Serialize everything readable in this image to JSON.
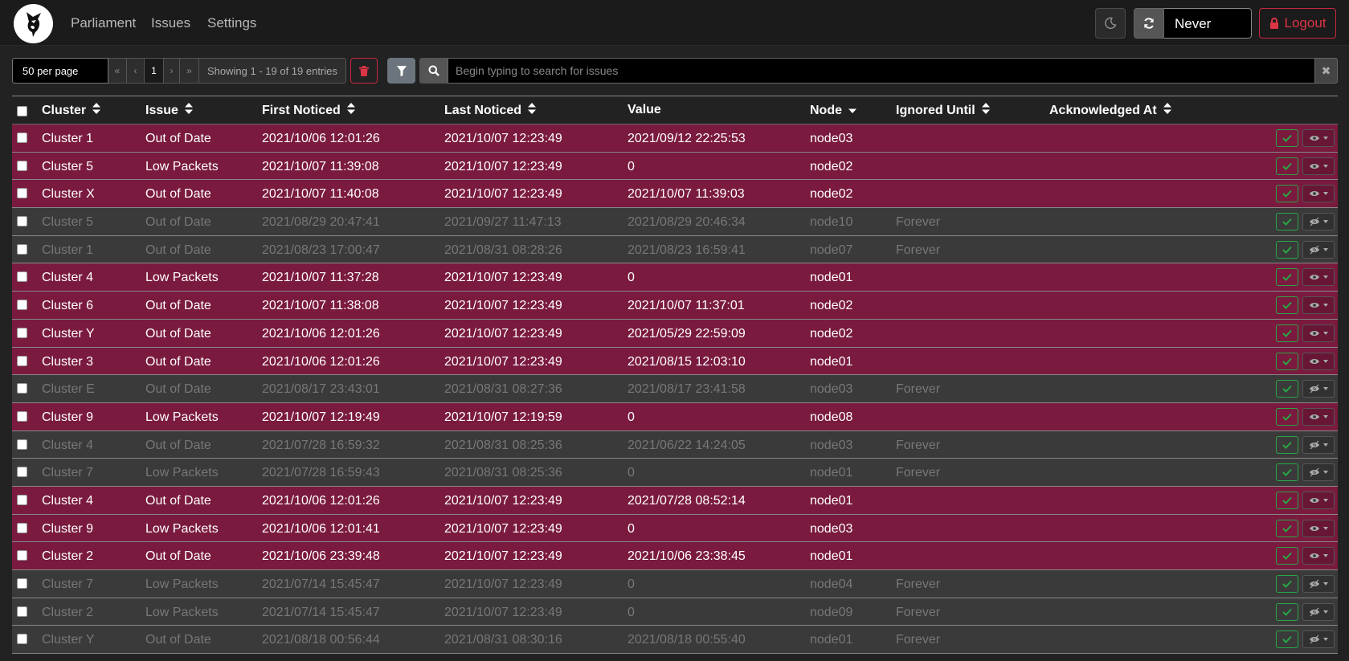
{
  "nav": {
    "links": [
      "Parliament",
      "Issues",
      "Settings"
    ],
    "refresh_value": "Never",
    "logout_label": "Logout"
  },
  "toolbar": {
    "per_page": "50 per page",
    "first": "«",
    "prev": "‹",
    "page": "1",
    "next": "›",
    "last": "»",
    "showing": "Showing 1 - 19 of 19 entries",
    "search_placeholder": "Begin typing to search for issues",
    "clear": "✖"
  },
  "columns": [
    "Cluster",
    "Issue",
    "First Noticed",
    "Last Noticed",
    "Value",
    "Node",
    "Ignored Until",
    "Acknowledged At"
  ],
  "colors": {
    "active_row": "#7a1a3f",
    "ignored_row": "#3a3a3a",
    "danger": "#dc3545",
    "success": "#28a745"
  },
  "rows": [
    {
      "cluster": "Cluster 1",
      "issue": "Out of Date",
      "first": "2021/10/06 12:01:26",
      "last": "2021/10/07 12:23:49",
      "value": "2021/09/12 22:25:53",
      "node": "node03",
      "ignored": "",
      "ack": "",
      "state": "active"
    },
    {
      "cluster": "Cluster 5",
      "issue": "Low Packets",
      "first": "2021/10/07 11:39:08",
      "last": "2021/10/07 12:23:49",
      "value": "0",
      "node": "node02",
      "ignored": "",
      "ack": "",
      "state": "active"
    },
    {
      "cluster": "Cluster X",
      "issue": "Out of Date",
      "first": "2021/10/07 11:40:08",
      "last": "2021/10/07 12:23:49",
      "value": "2021/10/07 11:39:03",
      "node": "node02",
      "ignored": "",
      "ack": "",
      "state": "active"
    },
    {
      "cluster": "Cluster 5",
      "issue": "Out of Date",
      "first": "2021/08/29 20:47:41",
      "last": "2021/09/27 11:47:13",
      "value": "2021/08/29 20:46:34",
      "node": "node10",
      "ignored": "Forever",
      "ack": "",
      "state": "ignored"
    },
    {
      "cluster": "Cluster 1",
      "issue": "Out of Date",
      "first": "2021/08/23 17:00:47",
      "last": "2021/08/31 08:28:26",
      "value": "2021/08/23 16:59:41",
      "node": "node07",
      "ignored": "Forever",
      "ack": "",
      "state": "ignored"
    },
    {
      "cluster": "Cluster 4",
      "issue": "Low Packets",
      "first": "2021/10/07 11:37:28",
      "last": "2021/10/07 12:23:49",
      "value": "0",
      "node": "node01",
      "ignored": "",
      "ack": "",
      "state": "active"
    },
    {
      "cluster": "Cluster 6",
      "issue": "Out of Date",
      "first": "2021/10/07 11:38:08",
      "last": "2021/10/07 12:23:49",
      "value": "2021/10/07 11:37:01",
      "node": "node02",
      "ignored": "",
      "ack": "",
      "state": "active"
    },
    {
      "cluster": "Cluster Y",
      "issue": "Out of Date",
      "first": "2021/10/06 12:01:26",
      "last": "2021/10/07 12:23:49",
      "value": "2021/05/29 22:59:09",
      "node": "node02",
      "ignored": "",
      "ack": "",
      "state": "active"
    },
    {
      "cluster": "Cluster 3",
      "issue": "Out of Date",
      "first": "2021/10/06 12:01:26",
      "last": "2021/10/07 12:23:49",
      "value": "2021/08/15 12:03:10",
      "node": "node01",
      "ignored": "",
      "ack": "",
      "state": "active"
    },
    {
      "cluster": "Cluster E",
      "issue": "Out of Date",
      "first": "2021/08/17 23:43:01",
      "last": "2021/08/31 08:27:36",
      "value": "2021/08/17 23:41:58",
      "node": "node03",
      "ignored": "Forever",
      "ack": "",
      "state": "ignored"
    },
    {
      "cluster": "Cluster 9",
      "issue": "Low Packets",
      "first": "2021/10/07 12:19:49",
      "last": "2021/10/07 12:19:59",
      "value": "0",
      "node": "node08",
      "ignored": "",
      "ack": "",
      "state": "active"
    },
    {
      "cluster": "Cluster 4",
      "issue": "Out of Date",
      "first": "2021/07/28 16:59:32",
      "last": "2021/08/31 08:25:36",
      "value": "2021/06/22 14:24:05",
      "node": "node03",
      "ignored": "Forever",
      "ack": "",
      "state": "ignored"
    },
    {
      "cluster": "Cluster 7",
      "issue": "Low Packets",
      "first": "2021/07/28 16:59:43",
      "last": "2021/08/31 08:25:36",
      "value": "0",
      "node": "node01",
      "ignored": "Forever",
      "ack": "",
      "state": "ignored"
    },
    {
      "cluster": "Cluster 4",
      "issue": "Out of Date",
      "first": "2021/10/06 12:01:26",
      "last": "2021/10/07 12:23:49",
      "value": "2021/07/28 08:52:14",
      "node": "node01",
      "ignored": "",
      "ack": "",
      "state": "active"
    },
    {
      "cluster": "Cluster 9",
      "issue": "Low Packets",
      "first": "2021/10/06 12:01:41",
      "last": "2021/10/07 12:23:49",
      "value": "0",
      "node": "node03",
      "ignored": "",
      "ack": "",
      "state": "active"
    },
    {
      "cluster": "Cluster 2",
      "issue": "Out of Date",
      "first": "2021/10/06 23:39:48",
      "last": "2021/10/07 12:23:49",
      "value": "2021/10/06 23:38:45",
      "node": "node01",
      "ignored": "",
      "ack": "",
      "state": "active"
    },
    {
      "cluster": "Cluster 7",
      "issue": "Low Packets",
      "first": "2021/07/14 15:45:47",
      "last": "2021/10/07 12:23:49",
      "value": "0",
      "node": "node04",
      "ignored": "Forever",
      "ack": "",
      "state": "ignored"
    },
    {
      "cluster": "Cluster 2",
      "issue": "Low Packets",
      "first": "2021/07/14 15:45:47",
      "last": "2021/10/07 12:23:49",
      "value": "0",
      "node": "node09",
      "ignored": "Forever",
      "ack": "",
      "state": "ignored"
    },
    {
      "cluster": "Cluster Y",
      "issue": "Out of Date",
      "first": "2021/08/18 00:56:44",
      "last": "2021/08/31 08:30:16",
      "value": "2021/08/18 00:55:40",
      "node": "node01",
      "ignored": "Forever",
      "ack": "",
      "state": "ignored"
    }
  ]
}
